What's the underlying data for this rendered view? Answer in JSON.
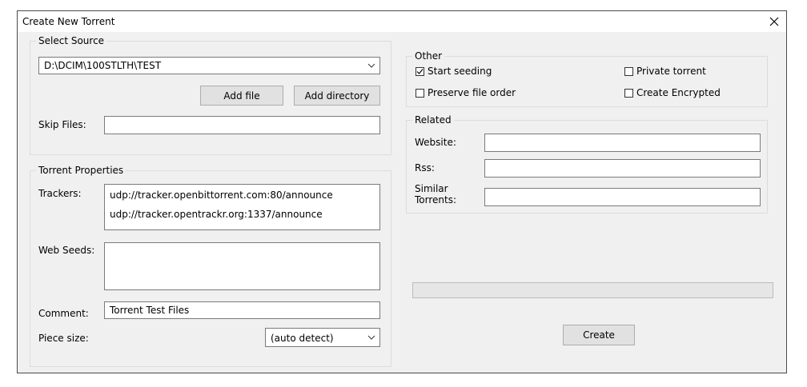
{
  "window": {
    "title": "Create New Torrent"
  },
  "select_source": {
    "legend": "Select Source",
    "path_value": "D:\\DCIM\\100STLTH\\TEST",
    "add_file_label": "Add file",
    "add_directory_label": "Add directory",
    "skip_files_label": "Skip Files:",
    "skip_files_value": ""
  },
  "torrent_properties": {
    "legend": "Torrent Properties",
    "trackers_label": "Trackers:",
    "trackers": [
      "udp://tracker.openbittorrent.com:80/announce",
      "udp://tracker.opentrackr.org:1337/announce"
    ],
    "web_seeds_label": "Web Seeds:",
    "web_seeds_value": "",
    "comment_label": "Comment:",
    "comment_value": "Torrent Test Files",
    "piece_size_label": "Piece size:",
    "piece_size_value": "(auto detect)"
  },
  "other": {
    "legend": "Other",
    "options": {
      "start_seeding": {
        "label": "Start seeding",
        "checked": true
      },
      "private_torrent": {
        "label": "Private torrent",
        "checked": false
      },
      "preserve_file_order": {
        "label": "Preserve file order",
        "checked": false
      },
      "create_encrypted": {
        "label": "Create Encrypted",
        "checked": false
      }
    }
  },
  "related": {
    "legend": "Related",
    "website_label": "Website:",
    "website_value": "",
    "rss_label": "Rss:",
    "rss_value": "",
    "similar_label_line1": "Similar",
    "similar_label_line2": "Torrents:",
    "similar_value": ""
  },
  "progress": {
    "value": 0
  },
  "create_label": "Create"
}
